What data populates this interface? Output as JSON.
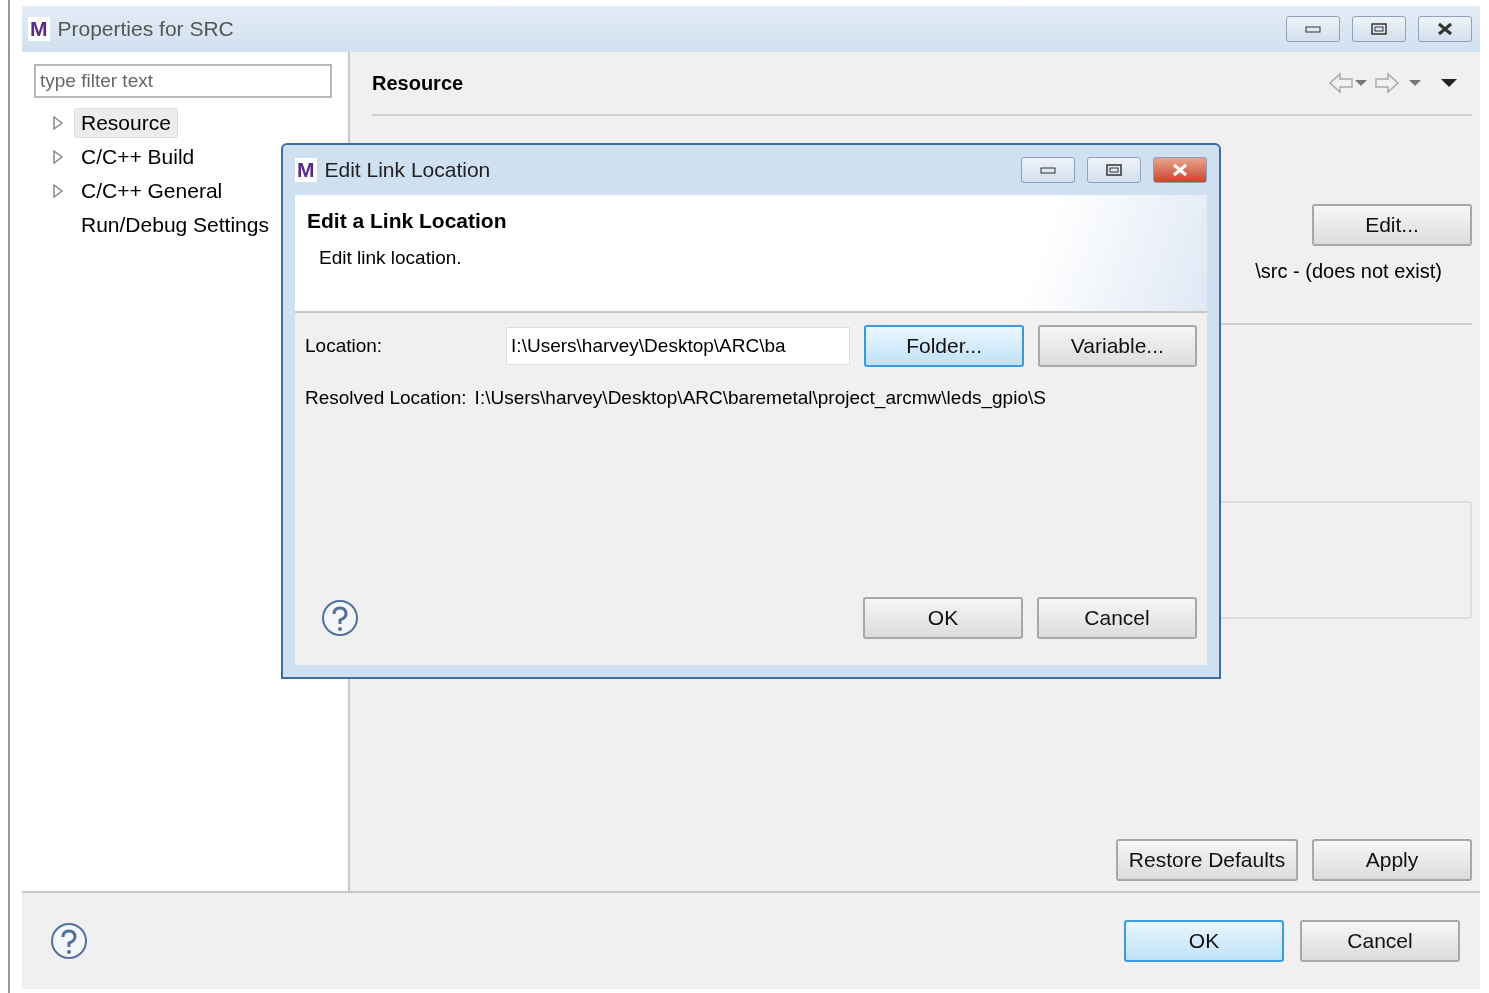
{
  "window": {
    "title": "Properties for SRC",
    "app_icon": "M"
  },
  "filter": {
    "placeholder": "type filter text"
  },
  "tree": [
    {
      "label": "Resource",
      "selected": true,
      "expandable": true
    },
    {
      "label": "C/C++ Build",
      "selected": false,
      "expandable": true
    },
    {
      "label": "C/C++ General",
      "selected": false,
      "expandable": true
    },
    {
      "label": "Run/Debug Settings",
      "selected": false,
      "expandable": false
    }
  ],
  "page": {
    "title": "Resource",
    "edit_button": "Edit...",
    "location_text": "\\src - (does not exist)"
  },
  "page_buttons": [
    "Restore Defaults",
    "Apply"
  ],
  "footer_buttons": [
    {
      "label": "OK",
      "default": true
    },
    {
      "label": "Cancel",
      "default": false
    }
  ],
  "dialog": {
    "title": "Edit Link Location",
    "app_icon": "M",
    "heading": "Edit a Link Location",
    "description": "Edit link location.",
    "location_label": "Location:",
    "location_value": "I:\\Users\\harvey\\Desktop\\ARC\\ba",
    "buttons": [
      {
        "label": "Folder...",
        "focused": true
      },
      {
        "label": "Variable...",
        "focused": false
      }
    ],
    "resolved_label": "Resolved Location:",
    "resolved_value": "I:\\Users\\harvey\\Desktop\\ARC\\baremetal\\project_arcmw\\leds_gpio\\S",
    "footer_buttons": [
      {
        "label": "OK"
      },
      {
        "label": "Cancel"
      }
    ]
  }
}
